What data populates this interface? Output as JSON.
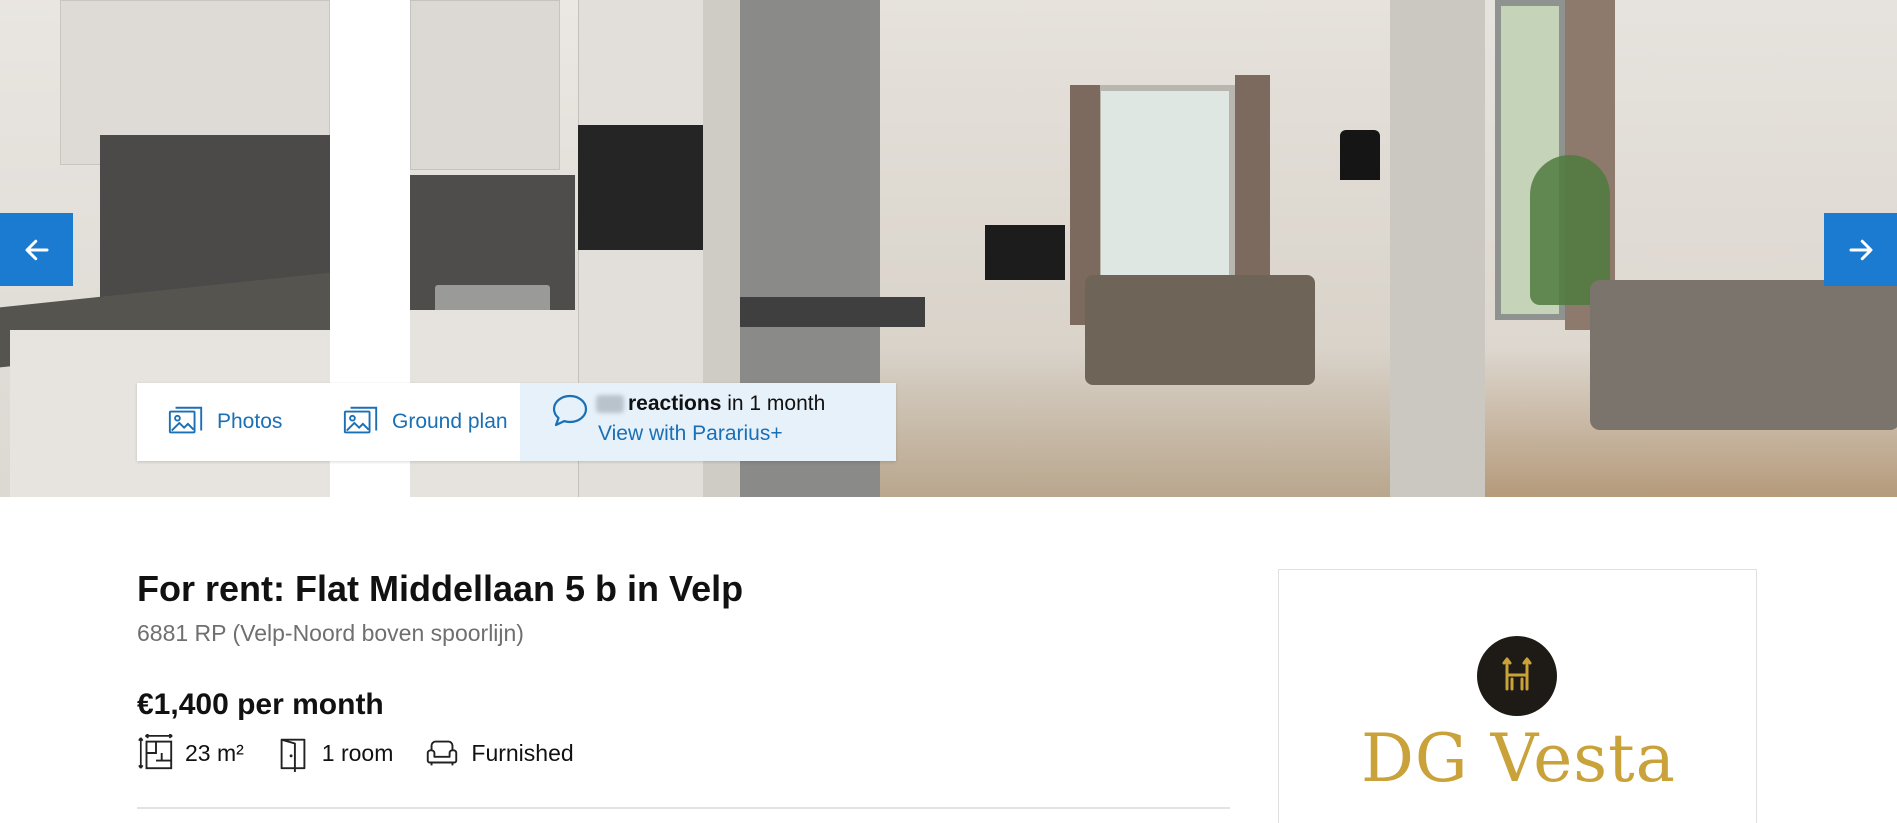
{
  "gallery": {
    "prev_icon": "arrow-left-icon",
    "next_icon": "arrow-right-icon",
    "accent_color": "#1a7bd1"
  },
  "media_bar": {
    "photos_label": "Photos",
    "photos_icon": "image-icon",
    "ground_plan_label": "Ground plan",
    "ground_plan_icon": "image-icon",
    "reactions_bold": "reactions",
    "reactions_suffix": " in 1 month",
    "reactions_icon": "chat-bubble-icon",
    "pararius_link": "View with Pararius+"
  },
  "listing": {
    "title": "For rent: Flat Middellaan 5 b in Velp",
    "subtitle": "6881 RP (Velp-Noord boven spoorlijn)",
    "price": "€1,400 per month",
    "features": [
      {
        "icon": "floor-area-icon",
        "label": "23 m²"
      },
      {
        "icon": "door-icon",
        "label": "1 room"
      },
      {
        "icon": "sofa-icon",
        "label": "Furnished"
      }
    ]
  },
  "agent": {
    "name": "DG Vesta",
    "brand_color": "#c9a23a"
  }
}
